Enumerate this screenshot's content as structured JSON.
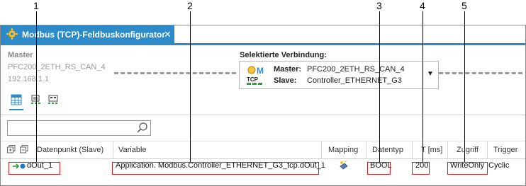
{
  "callouts": [
    "1",
    "2",
    "3",
    "4",
    "5"
  ],
  "tab": {
    "title": "Modbus (TCP)-Feldbuskonfigurator",
    "close_glyph": "✕",
    "icon": "config-gear-icon"
  },
  "master": {
    "label": "Master",
    "name": "PFC200_2ETH_RS_CAN_4",
    "ip": "192.168.1.1"
  },
  "connection": {
    "label": "Selektierte Verbindung:",
    "master_key": "Master:",
    "master_value": "PFC200_2ETH_RS_CAN_4",
    "slave_key": "Slave:",
    "slave_value": "Controller_ETHERNET_G3",
    "icon_text": "TCP",
    "dropdown_glyph": "▼"
  },
  "search": {
    "placeholder": ""
  },
  "columns": [
    "Datenpunkt (Slave)",
    "Variable",
    "Mapping",
    "Datentyp",
    "T [ms]",
    "Zugriff",
    "Trigger"
  ],
  "row": {
    "datapoint": "dOut_1",
    "variable": "Application. Modbus.Controller_ETHERNET_G3_tcp.dOut_1",
    "datatype": "BOOL",
    "interval": "200",
    "access": "WriteOnly",
    "trigger": "Cyclic"
  },
  "colors": {
    "accent": "#2e8bc9",
    "callout_box": "#d21f1f",
    "arrow_green": "#2f9e3d",
    "dot_blue": "#1f77c8"
  }
}
